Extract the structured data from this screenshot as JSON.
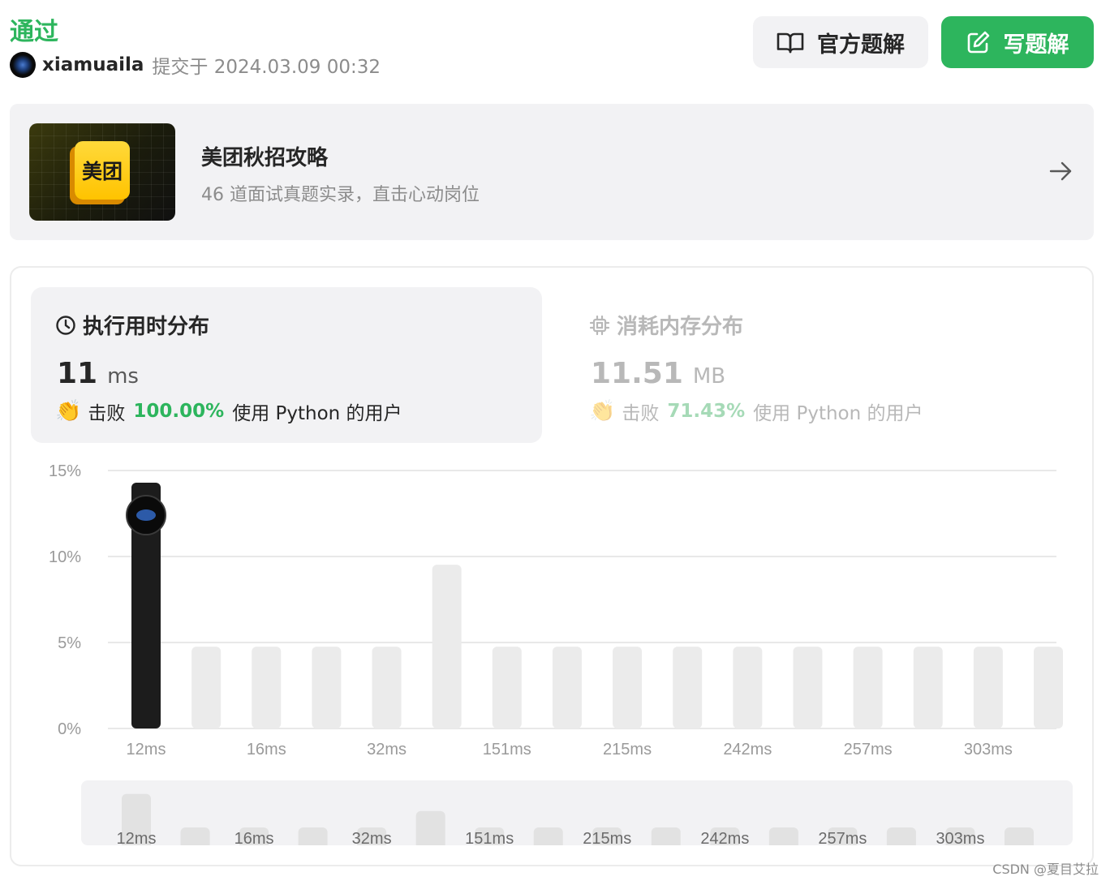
{
  "header": {
    "status": "通过",
    "username": "xiamuaila",
    "submitted_text": "提交于 2024.03.09 00:32"
  },
  "actions": {
    "official_label": "官方题解",
    "write_label": "写题解"
  },
  "banner": {
    "logo_text": "美团",
    "title": "美团秋招攻略",
    "subtitle": "46 道面试真题实录，直击心动岗位"
  },
  "runtime": {
    "title": "执行用时分布",
    "value": "11",
    "unit": "ms",
    "beat_label": "击败",
    "beat_pct": "100.00%",
    "beat_suffix": "使用 Python 的用户"
  },
  "memory": {
    "title": "消耗内存分布",
    "value": "11.51",
    "unit": "MB",
    "beat_label": "击败",
    "beat_pct": "71.43%",
    "beat_suffix": "使用 Python 的用户"
  },
  "colors": {
    "accent": "#2db55d",
    "bar_active": "#1c1c1c",
    "bar": "#ebebeb"
  },
  "chart_data": {
    "type": "bar",
    "ylim": [
      0,
      15
    ],
    "yticks": [
      "15%",
      "10%",
      "5%",
      "0%"
    ],
    "ytick_values": [
      15,
      10,
      5,
      0
    ],
    "values": [
      14.29,
      4.76,
      4.76,
      4.76,
      4.76,
      9.52,
      4.76,
      4.76,
      4.76,
      4.76,
      4.76,
      4.76,
      4.76,
      4.76,
      4.76,
      4.76
    ],
    "highlight_index": 0,
    "xlabels": [
      "12ms",
      "16ms",
      "32ms",
      "151ms",
      "215ms",
      "242ms",
      "257ms",
      "303ms"
    ],
    "xlabel_bar_index": [
      0,
      2,
      4,
      6,
      8,
      10,
      12,
      14
    ],
    "grid": true
  },
  "watermark": "CSDN @夏目艾拉"
}
